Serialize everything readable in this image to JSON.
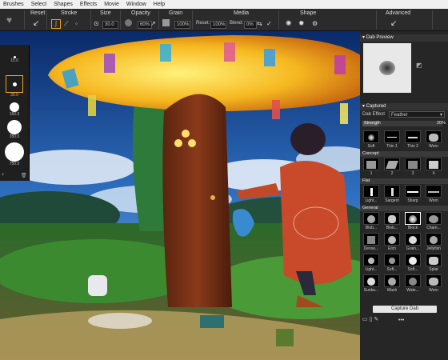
{
  "menu": [
    "Brushes",
    "Select",
    "Shapes",
    "Effects",
    "Movie",
    "Window",
    "Help"
  ],
  "toolbar": {
    "reset": "Reset",
    "stroke": "Stroke",
    "size": "Size",
    "size_value": "30.0",
    "opacity": "Opacity",
    "opacity_value": "60%",
    "grain": "Grain",
    "grain_value": "100%",
    "media": "Media",
    "media_reset_label": "Reset:",
    "media_reset_value": "100%",
    "media_blend_label": "Blend:",
    "media_blend_value": "0%",
    "shape": "Shape",
    "advanced": "Advanced"
  },
  "left_panel": {
    "sizes": [
      "15.0",
      "30.0",
      "150.0",
      "350.0",
      "750.0"
    ]
  },
  "right_panel": {
    "dab_preview_title": "Dab Preview",
    "captured_title": "Captured",
    "dab_effect_label": "Dab Effect",
    "dab_effect_value": "Feather",
    "strength_label": "Strength",
    "strength_value": "20%",
    "row1": [
      "Soft",
      "Thin 1",
      "Thin 2",
      "Worn"
    ],
    "category_concept": "Concept",
    "row2": [
      "1",
      "2",
      "3",
      "4"
    ],
    "category_flat": "Flat",
    "row3": [
      "Light...",
      "Sargent",
      "Sharp",
      "Worn"
    ],
    "category_general": "General",
    "row4": [
      "Blob...",
      "Blob...",
      "Block",
      "Cham..."
    ],
    "row5": [
      "Dense...",
      "Etch",
      "Grain...",
      "Jellyfish"
    ],
    "row6": [
      "Light...",
      "Soft...",
      "Soft...",
      "Splat"
    ],
    "row7": [
      "Sunbu...",
      "Wash",
      "Wate...",
      "Worn"
    ],
    "capture_button": "Capture Dab"
  },
  "colors": {
    "panel_bg": "#262626",
    "toolbar_bg": "#2b2b2b",
    "accent_orange": "#f0a020"
  }
}
